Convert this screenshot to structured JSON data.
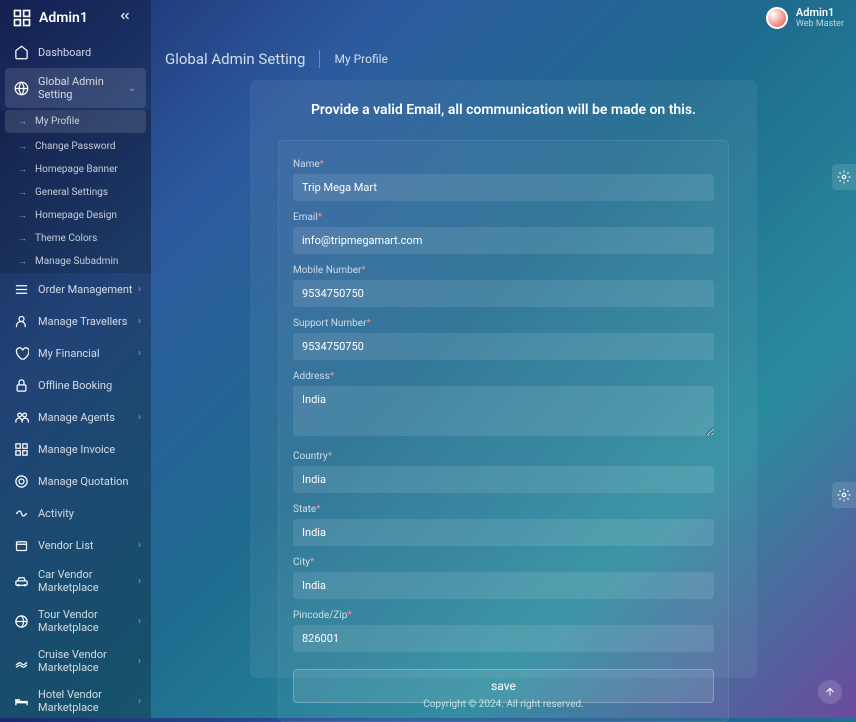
{
  "app_name": "Admin1",
  "header": {
    "user_name": "Admin1",
    "user_role": "Web Master"
  },
  "breadcrumb": {
    "section": "Global Admin Setting",
    "page": "My Profile"
  },
  "sidebar": {
    "dashboard": "Dashboard",
    "global_admin": "Global Admin Setting",
    "sub": {
      "my_profile": "My Profile",
      "change_password": "Change Password",
      "homepage_banner": "Homepage Banner",
      "general_settings": "General Settings",
      "homepage_design": "Homepage Design",
      "theme_colors": "Theme Colors",
      "manage_subadmin": "Manage Subadmin"
    },
    "order_management": "Order Management",
    "manage_travellers": "Manage Travellers",
    "my_financial": "My Financial",
    "offline_booking": "Offline Booking",
    "manage_agents": "Manage Agents",
    "manage_invoice": "Manage Invoice",
    "manage_quotation": "Manage Quotation",
    "activity": "Activity",
    "vendor_list": "Vendor List",
    "car_vendor": "Car Vendor Marketplace",
    "tour_vendor": "Tour Vendor Marketplace",
    "cruise_vendor": "Cruise Vendor Marketplace",
    "hotel_vendor": "Hotel Vendor Marketplace"
  },
  "panel": {
    "title": "Provide a valid Email, all communication will be made on this.",
    "labels": {
      "name": "Name",
      "email": "Email",
      "mobile": "Mobile Number",
      "support": "Support Number",
      "address": "Address",
      "country": "Country",
      "state": "State",
      "city": "City",
      "pincode": "Pincode/Zip"
    },
    "values": {
      "name": "Trip Mega Mart",
      "email": "info@tripmegamart.com",
      "mobile": "9534750750",
      "support": "9534750750",
      "address": "India",
      "country": "India",
      "state": "India",
      "city": "India",
      "pincode": "826001"
    },
    "save": "save",
    "req": "*"
  },
  "footer": "Copyright © 2024. All right reserved."
}
